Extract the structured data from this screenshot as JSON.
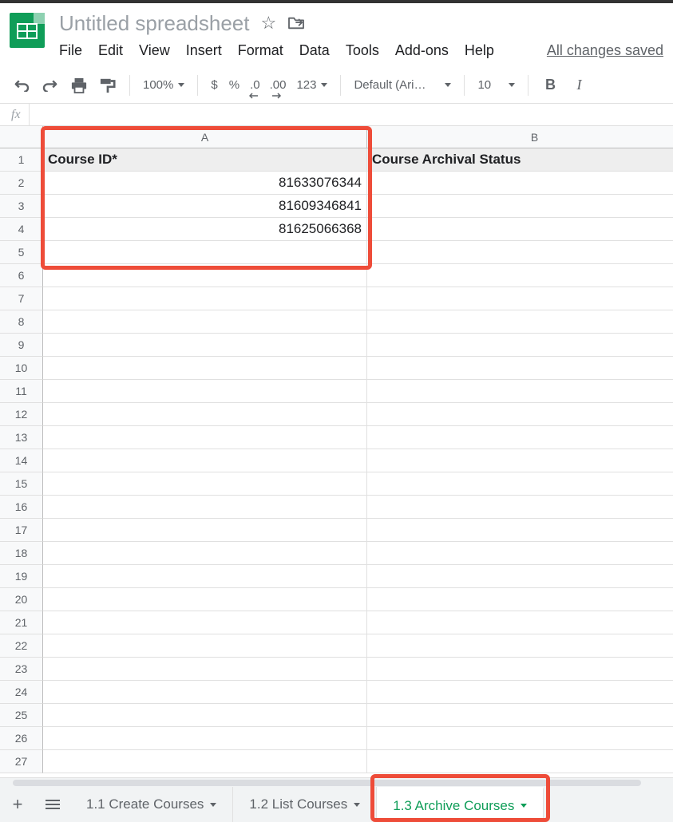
{
  "doc": {
    "title": "Untitled spreadsheet",
    "save_status": "All changes saved"
  },
  "menus": [
    "File",
    "Edit",
    "View",
    "Insert",
    "Format",
    "Data",
    "Tools",
    "Add-ons",
    "Help"
  ],
  "toolbar": {
    "zoom": "100%",
    "currency": "$",
    "percent": "%",
    "dec_minus": ".0",
    "dec_plus": ".00",
    "num_format": "123",
    "font": "Default (Ari…",
    "font_size": "10",
    "bold": "B",
    "italic": "I"
  },
  "formula_prefix": "fx",
  "columns": {
    "a": "A",
    "b": "B"
  },
  "sheet": {
    "header_a": "Course ID*",
    "header_b": "Course Archival Status",
    "rows": [
      "81633076344",
      "81609346841",
      "81625066368"
    ]
  },
  "tabs": {
    "t1": "1.1 Create Courses",
    "t2": "1.2 List Courses",
    "t3": "1.3 Archive Courses"
  }
}
